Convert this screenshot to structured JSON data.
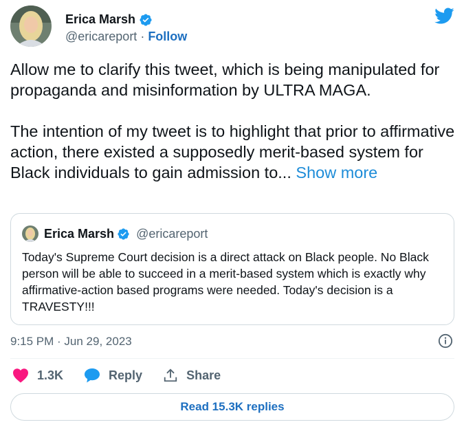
{
  "author": {
    "name": "Erica Marsh",
    "handle": "@ericareport",
    "separator": "·",
    "follow_label": "Follow"
  },
  "tweet": {
    "text": "Allow me to clarify this tweet, which is being manipulated for propaganda and misinformation by ULTRA MAGA.\n\nThe intention of my tweet is to highlight that prior to affirmative action, there existed a supposedly merit-based system for Black individuals to gain admission to... ",
    "show_more": "Show more"
  },
  "quoted_tweet": {
    "name": "Erica Marsh",
    "handle": "@ericareport",
    "text": "Today's Supreme Court decision is a direct attack on Black people. No Black person will be able to succeed in a merit-based system which is exactly why affirmative-action based programs were needed. Today's decision is a TRAVESTY!!!"
  },
  "timestamp": "9:15 PM · Jun 29, 2023",
  "actions": {
    "likes": "1.3K",
    "reply_label": "Reply",
    "share_label": "Share"
  },
  "read_replies": "Read 15.3K replies",
  "colors": {
    "accent": "#1d9bf0",
    "like": "#f91880",
    "text": "#0f1419",
    "muted": "#536471"
  },
  "icons": {
    "verified": "verified-badge-icon",
    "logo": "twitter-bird-icon",
    "info": "info-icon",
    "like": "heart-icon",
    "reply": "chat-bubble-icon",
    "share": "share-upload-icon"
  }
}
